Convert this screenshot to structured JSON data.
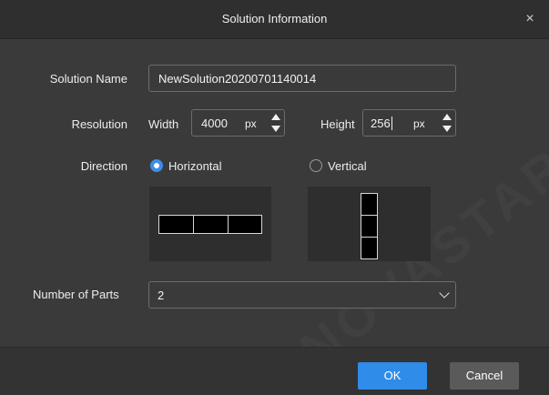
{
  "dialog": {
    "title": "Solution Information",
    "close_glyph": "×"
  },
  "solution_name": {
    "label": "Solution Name",
    "value": "NewSolution20200701140014"
  },
  "resolution": {
    "label": "Resolution",
    "width_label": "Width",
    "width_value": "4000",
    "width_unit": "px",
    "height_label": "Height",
    "height_value": "256",
    "height_unit": "px"
  },
  "direction": {
    "label": "Direction",
    "options": [
      {
        "label": "Horizontal",
        "selected": true
      },
      {
        "label": "Vertical",
        "selected": false
      }
    ]
  },
  "parts": {
    "label": "Number of Parts",
    "value": "2",
    "preview_cells": 3
  },
  "buttons": {
    "ok": "OK",
    "cancel": "Cancel"
  },
  "watermark": "NOVASTAR",
  "colors": {
    "accent": "#2f8ce8",
    "dialog_bg": "#3a3a3a"
  },
  "icons": [
    "close-icon",
    "spin-up-icon",
    "spin-down-icon",
    "chevron-down-icon"
  ]
}
